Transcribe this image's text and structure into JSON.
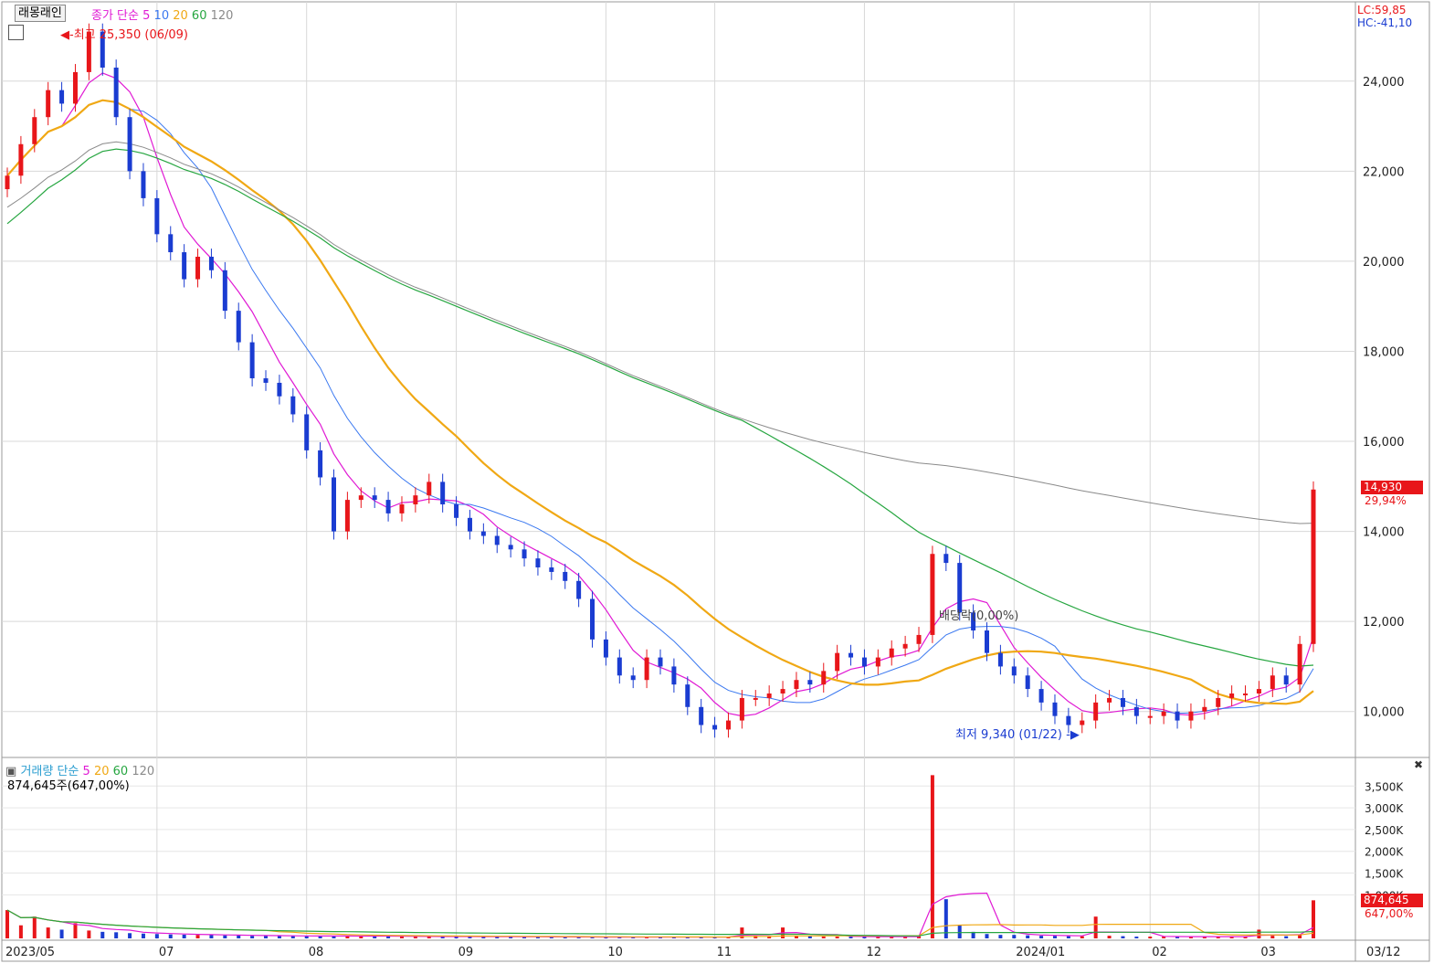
{
  "header": {
    "stock_name": "래몽래인",
    "price_legend": {
      "label": "종가 단순",
      "ma": [
        "5",
        "10",
        "20",
        "60",
        "120"
      ]
    },
    "volume_legend": {
      "label": "거래량 단순",
      "ma": [
        "5",
        "20",
        "60",
        "120"
      ]
    },
    "volume_current": "874,645주(647,00%)",
    "lc": "LC:59,85",
    "hc": "HC:-41,10"
  },
  "price_badge": {
    "price": "14,930",
    "change": "29,94%"
  },
  "volume_badge": {
    "volume": "874,645",
    "change": "647,00%"
  },
  "annotations": {
    "high": "최고 25,350 (06/09)",
    "low": "최저 9,340 (01/22)",
    "dividend": "배당락(0,00%)"
  },
  "colors": {
    "up": "#e8161a",
    "down": "#1a3cd1",
    "ma5": "#e01ad4",
    "ma10": "#3a78f0",
    "ma20": "#f0a814",
    "ma60": "#26a640",
    "ma120": "#8a8a8a",
    "grid": "#d8d8d8"
  },
  "chart_data": [
    {
      "type": "line",
      "panel": "price",
      "ylim": [
        9000,
        25700
      ],
      "y_ticks": [
        "24,000",
        "22,000",
        "20,000",
        "18,000",
        "16,000",
        "14,000",
        "12,000",
        "10,000"
      ],
      "x_ticks": [
        "2023/05",
        "07",
        "08",
        "09",
        "10",
        "11",
        "12",
        "2024/01",
        "02",
        "03",
        "03/12"
      ],
      "series": [
        {
          "name": "종가",
          "values": [
            21900,
            22600,
            23200,
            23800,
            23500,
            24200,
            25100,
            24300,
            23200,
            22000,
            21400,
            20600,
            20200,
            19600,
            20100,
            19800,
            18900,
            18200,
            17400,
            17300,
            17000,
            16600,
            15800,
            15200,
            14000,
            14700,
            14800,
            14700,
            14400,
            14600,
            14800,
            15100,
            14600,
            14300,
            14000,
            13900,
            13700,
            13600,
            13400,
            13200,
            13100,
            12900,
            12500,
            11600,
            11200,
            10800,
            10700,
            11200,
            11000,
            10600,
            10100,
            9700,
            9600,
            9800,
            10300,
            10300,
            10400,
            10500,
            10700,
            10600,
            10900,
            11300,
            11200,
            11000,
            11200,
            11400,
            11500,
            11700,
            13500,
            13300,
            12200,
            11800,
            11300,
            11000,
            10800,
            10500,
            10200,
            9900,
            9700,
            9800,
            10200,
            10300,
            10100,
            9900,
            9900,
            10000,
            9800,
            10000,
            10100,
            10300,
            10400,
            10400,
            10500,
            10800,
            10600,
            11500,
            14930
          ]
        }
      ]
    },
    {
      "type": "bar",
      "panel": "volume",
      "ylim": [
        0,
        3800000
      ],
      "y_ticks": [
        "3,500K",
        "3,000K",
        "2,500K",
        "2,000K",
        "1,500K",
        "1,000K"
      ],
      "series": [
        {
          "name": "거래량",
          "values": [
            650000,
            300000,
            500000,
            250000,
            200000,
            350000,
            180000,
            150000,
            140000,
            120000,
            110000,
            100000,
            90000,
            85000,
            80000,
            75000,
            70000,
            65000,
            60000,
            60000,
            55000,
            55000,
            50000,
            50000,
            60000,
            55000,
            50000,
            50000,
            45000,
            45000,
            40000,
            45000,
            40000,
            40000,
            40000,
            35000,
            35000,
            35000,
            35000,
            35000,
            30000,
            30000,
            30000,
            30000,
            30000,
            30000,
            30000,
            30000,
            30000,
            30000,
            30000,
            30000,
            30000,
            30000,
            250000,
            60000,
            50000,
            250000,
            60000,
            50000,
            40000,
            40000,
            40000,
            35000,
            40000,
            40000,
            35000,
            50000,
            3750000,
            900000,
            300000,
            150000,
            100000,
            80000,
            80000,
            70000,
            60000,
            60000,
            50000,
            50000,
            500000,
            60000,
            50000,
            40000,
            40000,
            40000,
            40000,
            40000,
            40000,
            40000,
            40000,
            40000,
            200000,
            60000,
            50000,
            80000,
            874645
          ]
        }
      ]
    }
  ]
}
